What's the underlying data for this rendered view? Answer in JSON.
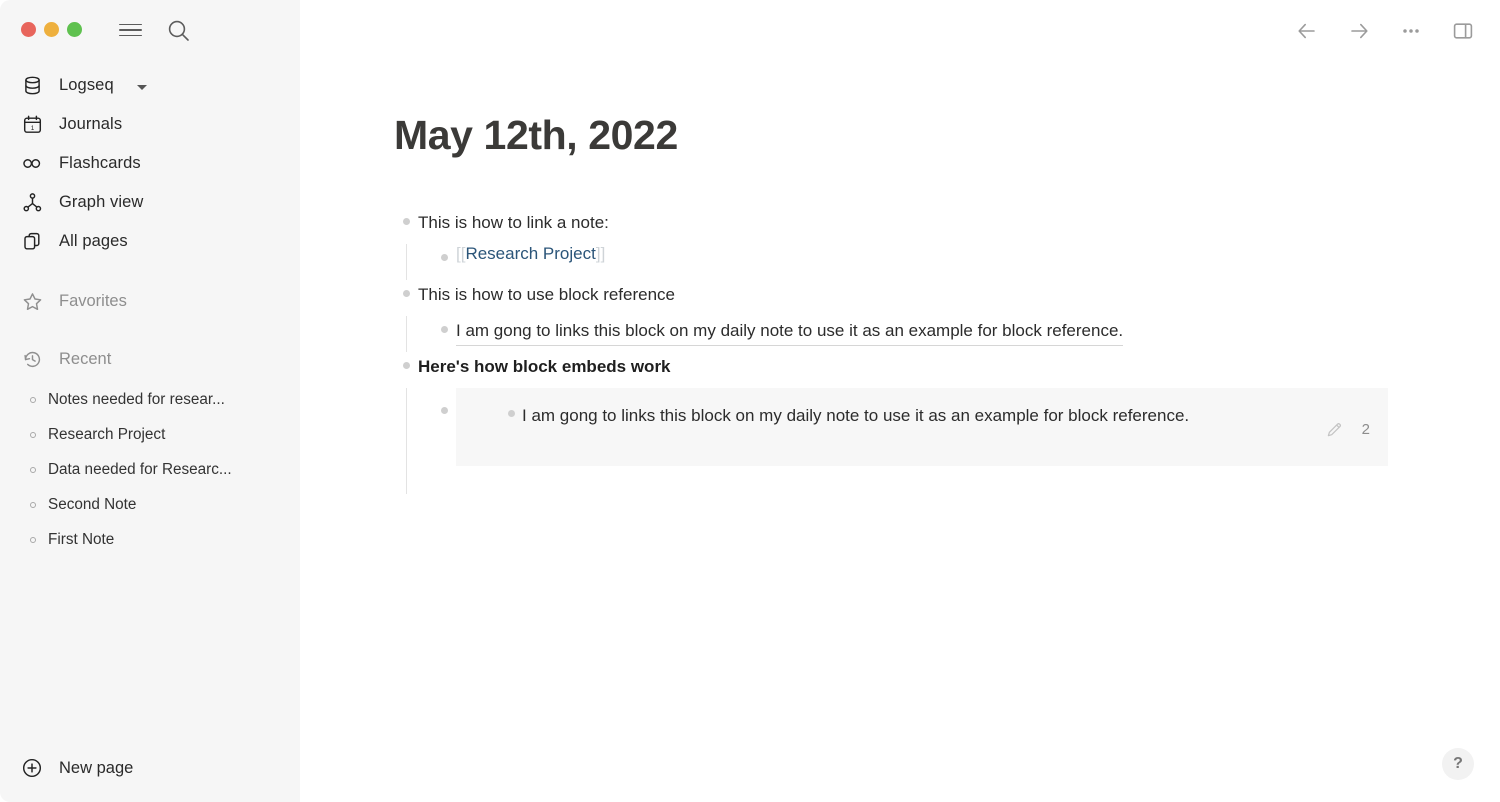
{
  "window": {
    "traffic_lights": [
      {
        "name": "close",
        "color": "#e8655c"
      },
      {
        "name": "minimize",
        "color": "#eeb03e"
      },
      {
        "name": "maximize",
        "color": "#5fc14f"
      }
    ]
  },
  "sidebar": {
    "graph": {
      "label": "Logseq",
      "icon": "database-icon",
      "chevron": "chevron-down-icon"
    },
    "nav": [
      {
        "label": "Journals",
        "icon": "calendar-icon"
      },
      {
        "label": "Flashcards",
        "icon": "infinity-icon"
      },
      {
        "label": "Graph view",
        "icon": "graph-icon"
      },
      {
        "label": "All pages",
        "icon": "pages-icon"
      }
    ],
    "favorites": {
      "label": "Favorites",
      "icon": "star-icon"
    },
    "recent": {
      "label": "Recent",
      "icon": "history-icon",
      "items": [
        {
          "label": "Notes needed for resear..."
        },
        {
          "label": "Research Project"
        },
        {
          "label": "Data needed for Researc..."
        },
        {
          "label": "Second Note"
        },
        {
          "label": "First Note"
        }
      ]
    },
    "new_page": {
      "label": "New page",
      "icon": "plus-circle-icon"
    },
    "hamburger_icon": "menu-icon",
    "search_icon": "search-icon"
  },
  "toolbar": {
    "back": "back-arrow-icon",
    "forward": "forward-arrow-icon",
    "more": "ellipsis-icon",
    "right_sidebar": "right-sidebar-icon"
  },
  "page": {
    "title": "May 12th, 2022",
    "blocks": {
      "b1": {
        "text": "This is how to link a note:",
        "child_ref": {
          "open_bracket": "[[",
          "link": "Research Project",
          "close_bracket": "]]"
        }
      },
      "b2": {
        "text": "This is how to use block reference",
        "child_block_ref": "I am gong to links this block on my daily note to use it as an example for block reference."
      },
      "b3": {
        "text": "Here's how block embeds work",
        "embed": {
          "text": "I am gong to links this block on my daily note to use it as an example for block reference.",
          "edit_icon": "pencil-icon",
          "count": "2"
        }
      }
    }
  },
  "help": {
    "label": "?"
  },
  "colors": {
    "sidebar_bg": "#f6f6f6",
    "main_bg": "#ffffff",
    "link": "#2b5579",
    "bracket": "#cfd4d8",
    "embed_bg": "#f7f7f7",
    "bullet": "#cfcfcf",
    "muted_text": "#8e8e8e"
  }
}
